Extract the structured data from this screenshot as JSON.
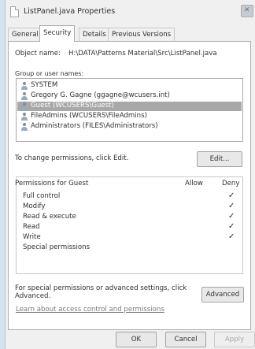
{
  "window": {
    "title": "ListPanel.java Properties",
    "close_glyph": "✕"
  },
  "tabs": [
    {
      "label": "General"
    },
    {
      "label": "Security",
      "active": true
    },
    {
      "label": "Details"
    },
    {
      "label": "Previous Versions"
    }
  ],
  "object": {
    "label": "Object name:",
    "value": "H:\\DATA\\Patterns Material\\Src\\ListPanel.java"
  },
  "groups": {
    "label": "Group or user names:",
    "items": [
      {
        "label": "SYSTEM",
        "icon": "user-group-icon"
      },
      {
        "label": "Gregory G. Gagne (ggagne@wcusers.int)",
        "icon": "user-icon"
      },
      {
        "label": "Guest (WCUSERS\\Guest)",
        "icon": "user-icon",
        "selected": true
      },
      {
        "label": "FileAdmins (WCUSERS\\FileAdmins)",
        "icon": "user-group-icon"
      },
      {
        "label": "Administrators (FILES\\Administrators)",
        "icon": "user-group-icon"
      }
    ]
  },
  "change_hint": "To change permissions, click Edit.",
  "edit_button": "Edit...",
  "permissions": {
    "header": "Permissions for Guest",
    "allow_label": "Allow",
    "deny_label": "Deny",
    "check_glyph": "✓",
    "rows": [
      {
        "name": "Full control",
        "deny": true
      },
      {
        "name": "Modify",
        "deny": true
      },
      {
        "name": "Read & execute",
        "deny": true
      },
      {
        "name": "Read",
        "deny": true
      },
      {
        "name": "Write",
        "deny": true
      },
      {
        "name": "Special permissions",
        "deny": false
      }
    ]
  },
  "special_hint": "For special permissions or advanced settings, click Advanced.",
  "advanced_button": "Advanced",
  "learn_link": "Learn about access control and permissions",
  "footer": {
    "ok": "OK",
    "cancel": "Cancel",
    "apply": "Apply"
  },
  "colors": {
    "selection": "#a8a8a8",
    "window_bg": "#f0f0f0"
  }
}
